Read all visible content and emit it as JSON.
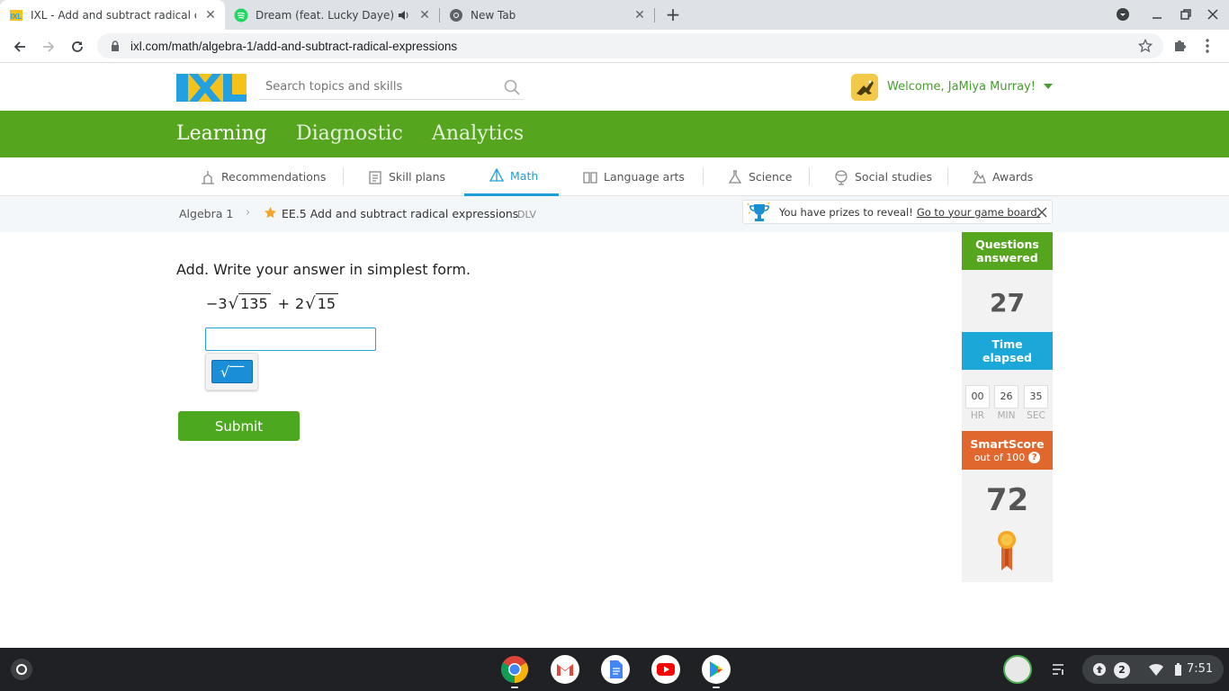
{
  "browser": {
    "tabs": [
      {
        "title": "IXL - Add and subtract radical ex",
        "active": true
      },
      {
        "title": "Dream (feat. Lucky Daye) · Q",
        "active": false,
        "audio": true
      },
      {
        "title": "New Tab",
        "active": false
      }
    ],
    "url": "ixl.com/math/algebra-1/add-and-subtract-radical-expressions"
  },
  "header": {
    "search_placeholder": "Search topics and skills",
    "welcome": "Welcome, JaMiya Murray!"
  },
  "nav": {
    "items": [
      "Learning",
      "Diagnostic",
      "Analytics"
    ],
    "active": "Learning"
  },
  "subnav": {
    "items": [
      "Recommendations",
      "Skill plans",
      "Math",
      "Language arts",
      "Science",
      "Social studies",
      "Awards"
    ],
    "active": "Math"
  },
  "breadcrumb": {
    "course": "Algebra 1",
    "skill": "EE.5 Add and subtract radical expressions",
    "code": "DLV"
  },
  "prize_banner": {
    "text": "You have prizes to reveal!",
    "link": "Go to your game board."
  },
  "question": {
    "prompt": "Add. Write your answer in simplest form.",
    "term1_coef": "−3",
    "term1_rad": "135",
    "op": "+",
    "term2_coef": "2",
    "term2_rad": "15",
    "answer_value": "",
    "submit_label": "Submit"
  },
  "side_panel": {
    "questions_label_1": "Questions",
    "questions_label_2": "answered",
    "questions_count": "27",
    "time_label_1": "Time",
    "time_label_2": "elapsed",
    "time": {
      "hr": "00",
      "min": "26",
      "sec": "35"
    },
    "time_units": {
      "hr": "HR",
      "min": "MIN",
      "sec": "SEC"
    },
    "smartscore_label": "SmartScore",
    "smartscore_sub": "out of 100",
    "smartscore_help": "?",
    "smartscore": "72"
  },
  "shelf": {
    "notification_count": "2",
    "clock": "7:51"
  },
  "colors": {
    "ixl_green": "#56a51f",
    "ixl_blue": "#1ba8d8",
    "smartscore_orange": "#e0672d",
    "logo_blue": "#22a0e0",
    "logo_yellow": "#f5c21b"
  }
}
